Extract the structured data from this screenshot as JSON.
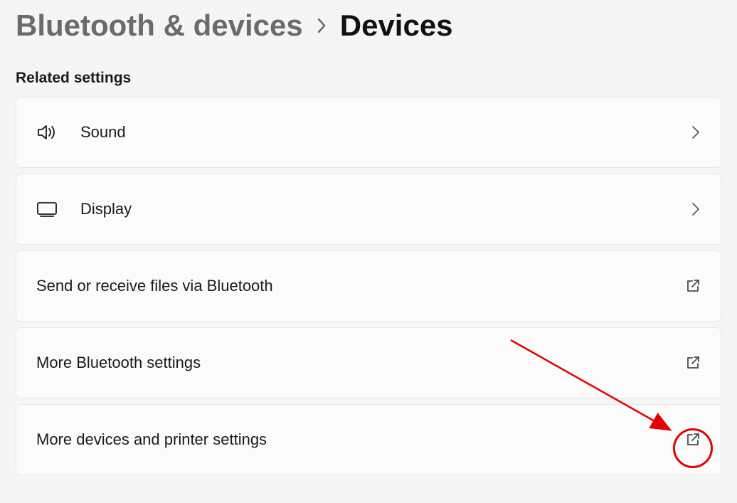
{
  "breadcrumb": {
    "parent": "Bluetooth & devices",
    "current": "Devices"
  },
  "section_title": "Related settings",
  "cards": [
    {
      "icon": "sound-icon",
      "label": "Sound",
      "action": "chevron"
    },
    {
      "icon": "display-icon",
      "label": "Display",
      "action": "chevron"
    },
    {
      "icon": "",
      "label": "Send or receive files via Bluetooth",
      "action": "open-external"
    },
    {
      "icon": "",
      "label": "More Bluetooth settings",
      "action": "open-external"
    },
    {
      "icon": "",
      "label": "More devices and printer settings",
      "action": "open-external"
    }
  ],
  "colors": {
    "annotation": "#e60000",
    "bg": "#f5f5f5",
    "card_bg": "#fbfbfb",
    "border": "#e8e8e8"
  }
}
